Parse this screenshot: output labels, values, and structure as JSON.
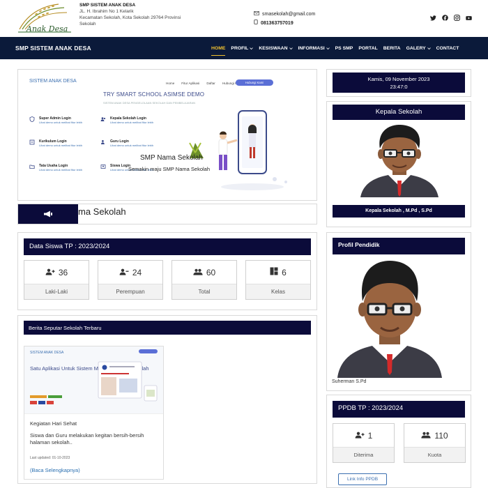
{
  "header": {
    "logo_text": "Anak Desa",
    "school_name": "SMP SISTEM ANAK DESA",
    "address_line1": "JL. H. Ibrahim No 1 Kelarik",
    "address_line2": "Kecamatan Sekolah, Kota Sekolah 29764 Provinsi",
    "address_line3": "Sekolah",
    "email": "smasekolah@gmail.com",
    "phone": "081363757019",
    "socials": [
      "twitter-icon",
      "facebook-icon",
      "instagram-icon",
      "youtube-icon"
    ]
  },
  "navbar": {
    "brand": "SMP SISTEM ANAK DESA",
    "items": [
      {
        "label": "HOME",
        "dropdown": false,
        "active": true
      },
      {
        "label": "PROFIL",
        "dropdown": true,
        "active": false
      },
      {
        "label": "KESISWAAN",
        "dropdown": true,
        "active": false
      },
      {
        "label": "INFORMASI",
        "dropdown": true,
        "active": false
      },
      {
        "label": "PS SMP",
        "dropdown": false,
        "active": false
      },
      {
        "label": "PORTAL",
        "dropdown": false,
        "active": false
      },
      {
        "label": "BERITA",
        "dropdown": false,
        "active": false
      },
      {
        "label": "GALERY",
        "dropdown": true,
        "active": false
      },
      {
        "label": "CONTACT",
        "dropdown": false,
        "active": false
      }
    ],
    "active_color": "#f2c230",
    "bg_color": "#0b1a3a"
  },
  "hero": {
    "app_name": "SISTEM ANAK DESA",
    "nav": [
      "Home",
      "Fitur Aplikasi",
      "Daftar",
      "Hubungi Kami",
      "Login"
    ],
    "nav_button": "Hubungi Kami",
    "title": "TRY SMART SCHOOL ASIMSE DEMO",
    "subtitle": "SISTEM ANAK DESA PENGELOLAAN SEKOLAH DAN PEMBELAJARAN",
    "features": [
      {
        "title": "Super Admin Login",
        "link": "Lihat demo untuk melihat fitur lebih"
      },
      {
        "title": "Kepala Sekolah Login",
        "link": "Lihat demo untuk melihat fitur lebih"
      },
      {
        "title": "Kurikulum Login",
        "link": "Lihat demo untuk melihat fitur lebih"
      },
      {
        "title": "Guru Login",
        "link": "Lihat demo untuk melihat fitur lebih"
      },
      {
        "title": "Tata Usaha Login",
        "link": "Lihat demo untuk melihat fitur lebih"
      },
      {
        "title": "Siswa Login",
        "link": "Lihat demo untuk melihat fitur lebih"
      }
    ],
    "caption": "SMP Nama Sekolah",
    "caption_sub": "Semakin maju SMP Nama Sekolah"
  },
  "running_text": "ma Sekolah",
  "data_siswa": {
    "title": "Data Siswa TP : 2023/2024",
    "stats": [
      {
        "icon": "user-plus-icon",
        "value": "36",
        "label": "Laki-Laki"
      },
      {
        "icon": "user-minus-icon",
        "value": "24",
        "label": "Perempuan"
      },
      {
        "icon": "users-icon",
        "value": "60",
        "label": "Total"
      },
      {
        "icon": "grid-icon",
        "value": "6",
        "label": "Kelas"
      }
    ]
  },
  "berita": {
    "title": "Berita Seputar Sekolah Terbaru",
    "thumb_heading": "Satu Aplikasi Untuk Sistem Managemen di Sekolah",
    "post_title": "Kegiatan Hari Sehat",
    "post_desc": "Siswa dan Guru melakukan kegitan bersih-bersih halaman sekolah..",
    "post_date": "Last updated: 01-10-2023",
    "read_more": "(Baca Selengkapnya)"
  },
  "sidebar": {
    "date_line1": "Kamis, 09 November 2023",
    "date_line2": "23:47:0",
    "kepala_title": "Kepala Sekolah",
    "kepala_name": "Kepala Sekolah , M.Pd , S.Pd",
    "profil_title": "Profil Pendidik",
    "profil_name": "Suherman S.Pd",
    "ppdb_title": "PPDB TP : 2023/2024",
    "ppdb_stats": [
      {
        "icon": "user-plus-icon",
        "value": "1",
        "label": "Diterima"
      },
      {
        "icon": "users-icon",
        "value": "110",
        "label": "Kuota"
      }
    ],
    "ppdb_link": "Link Info PPDB"
  }
}
